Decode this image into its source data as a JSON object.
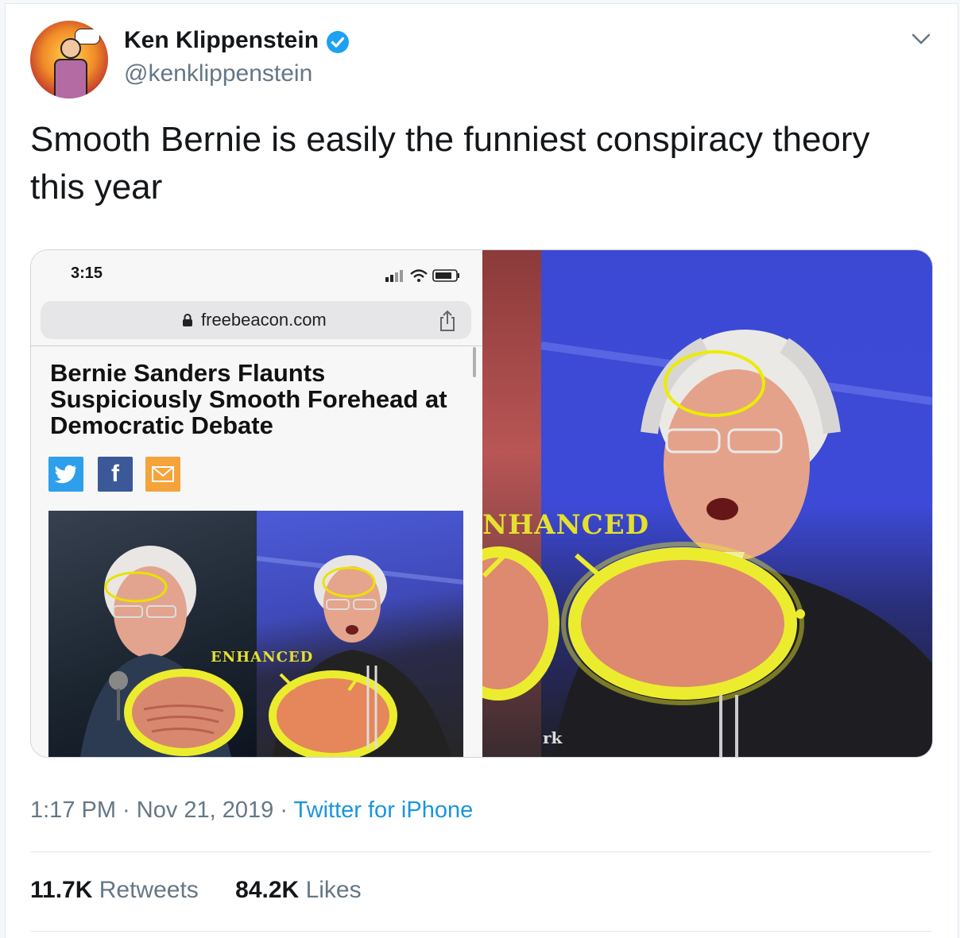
{
  "author": {
    "name": "Ken Klippenstein",
    "handle": "@kenklippenstein"
  },
  "tweet": {
    "text": "Smooth Bernie is easily the funniest conspiracy theory this year"
  },
  "screenshot": {
    "status_time": "3:15",
    "url": "freebeacon.com",
    "headline": "Bernie Sanders Flaunts Suspiciously Smooth Forehead at Democratic Debate",
    "share_buttons": {
      "twitter": "twitter-icon",
      "facebook": "f",
      "email": "mail-icon"
    },
    "inner_label": "ENHANCED"
  },
  "big_image": {
    "label": "NHANCED",
    "corner_text": "rk"
  },
  "meta": {
    "time": "1:17 PM",
    "sep1": " · ",
    "date": "Nov 21, 2019",
    "sep2": " · ",
    "source": "Twitter for iPhone"
  },
  "stats": {
    "retweets_count": "11.7K",
    "retweets_label": "Retweets",
    "likes_count": "84.2K",
    "likes_label": "Likes"
  },
  "colors": {
    "verified": "#1da1f2",
    "link": "#1b95e0",
    "highlight": "#e6e62a"
  }
}
